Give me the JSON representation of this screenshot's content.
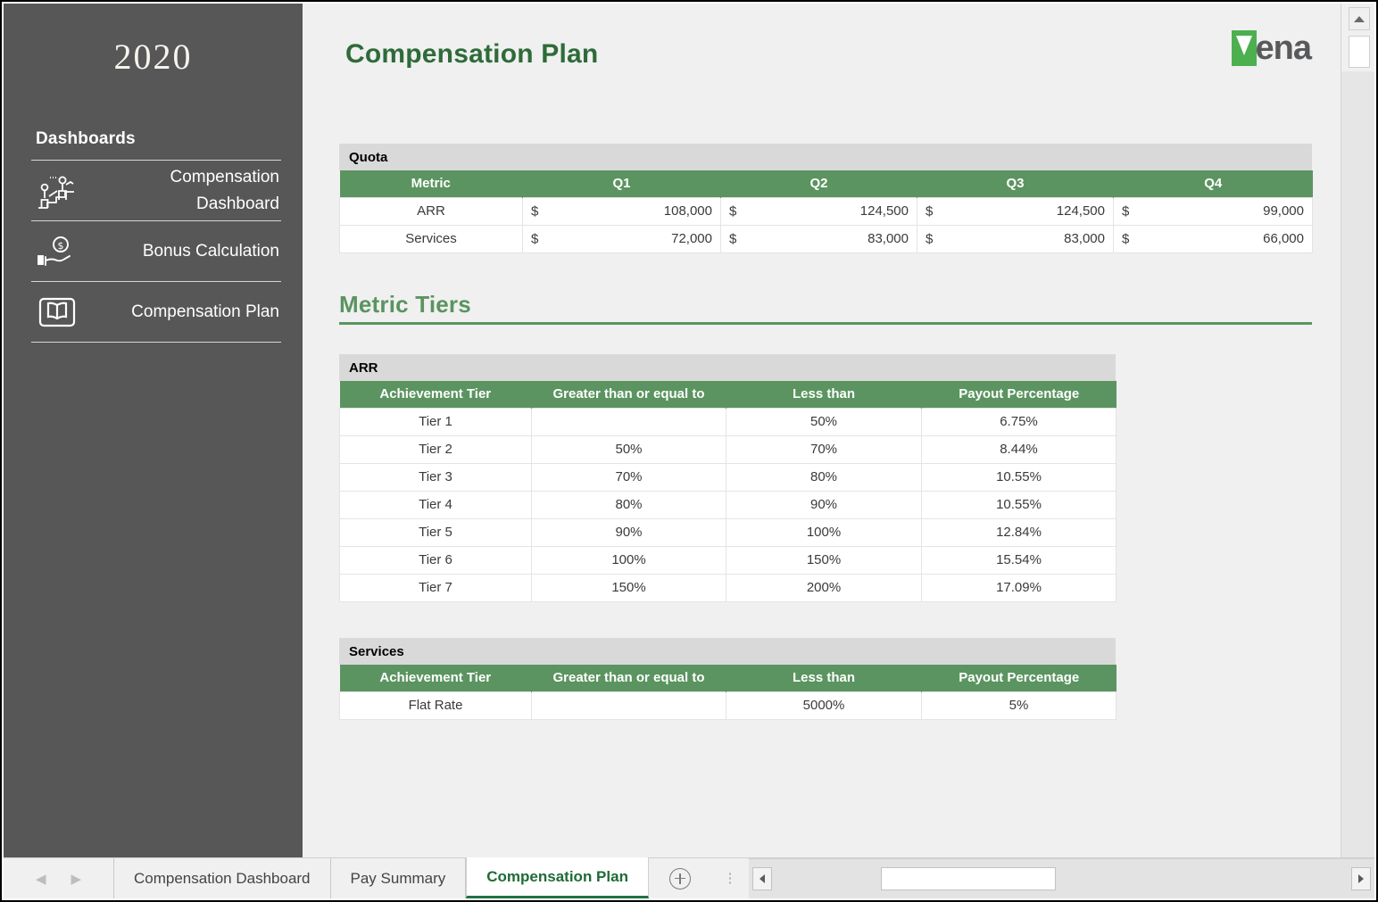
{
  "sidebar": {
    "year": "2020",
    "section_label": "Dashboards",
    "items": [
      {
        "label": "Compensation Dashboard",
        "icon": "people-stairs-icon"
      },
      {
        "label": "Bonus Calculation",
        "icon": "hand-coin-icon"
      },
      {
        "label": "Compensation Plan",
        "icon": "open-book-icon"
      }
    ]
  },
  "header": {
    "title": "Compensation Plan",
    "logo_text": "ena",
    "logo_alt": "Vena"
  },
  "quota": {
    "caption": "Quota",
    "columns": [
      "Metric",
      "Q1",
      "Q2",
      "Q3",
      "Q4"
    ],
    "rows": [
      {
        "metric": "ARR",
        "currency": "$",
        "q1": "108,000",
        "q2": "124,500",
        "q3": "124,500",
        "q4": "99,000"
      },
      {
        "metric": "Services",
        "currency": "$",
        "q1": "72,000",
        "q2": "83,000",
        "q3": "83,000",
        "q4": "66,000"
      }
    ]
  },
  "metric_tiers": {
    "section_title": "Metric Tiers",
    "columns": [
      "Achievement Tier",
      "Greater than or equal to",
      "Less than",
      "Payout Percentage"
    ],
    "arr": {
      "caption": "ARR",
      "rows": [
        {
          "tier": "Tier 1",
          "gte": "",
          "lt": "50%",
          "payout": "6.75%"
        },
        {
          "tier": "Tier 2",
          "gte": "50%",
          "lt": "70%",
          "payout": "8.44%"
        },
        {
          "tier": "Tier 3",
          "gte": "70%",
          "lt": "80%",
          "payout": "10.55%"
        },
        {
          "tier": "Tier 4",
          "gte": "80%",
          "lt": "90%",
          "payout": "10.55%"
        },
        {
          "tier": "Tier 5",
          "gte": "90%",
          "lt": "100%",
          "payout": "12.84%"
        },
        {
          "tier": "Tier 6",
          "gte": "100%",
          "lt": "150%",
          "payout": "15.54%"
        },
        {
          "tier": "Tier 7",
          "gte": "150%",
          "lt": "200%",
          "payout": "17.09%"
        }
      ]
    },
    "services": {
      "caption": "Services",
      "rows": [
        {
          "tier": "Flat Rate",
          "gte": "",
          "lt": "5000%",
          "payout": "5%"
        }
      ]
    }
  },
  "sheet_tabs": {
    "tabs": [
      {
        "label": "Compensation Dashboard",
        "active": false
      },
      {
        "label": "Pay Summary",
        "active": false
      },
      {
        "label": "Compensation Plan",
        "active": true
      }
    ],
    "add_sheet_icon": "plus-circle-icon",
    "prev_icon": "chevron-left-icon",
    "next_icon": "chevron-right-icon"
  },
  "colors": {
    "accent_green": "#5b9460",
    "title_green": "#2e6b39",
    "sidebar_gray": "#575757",
    "caption_gray": "#d9d9d9",
    "sheet_bg": "#f0f0f0",
    "logo_green": "#4caf50"
  }
}
